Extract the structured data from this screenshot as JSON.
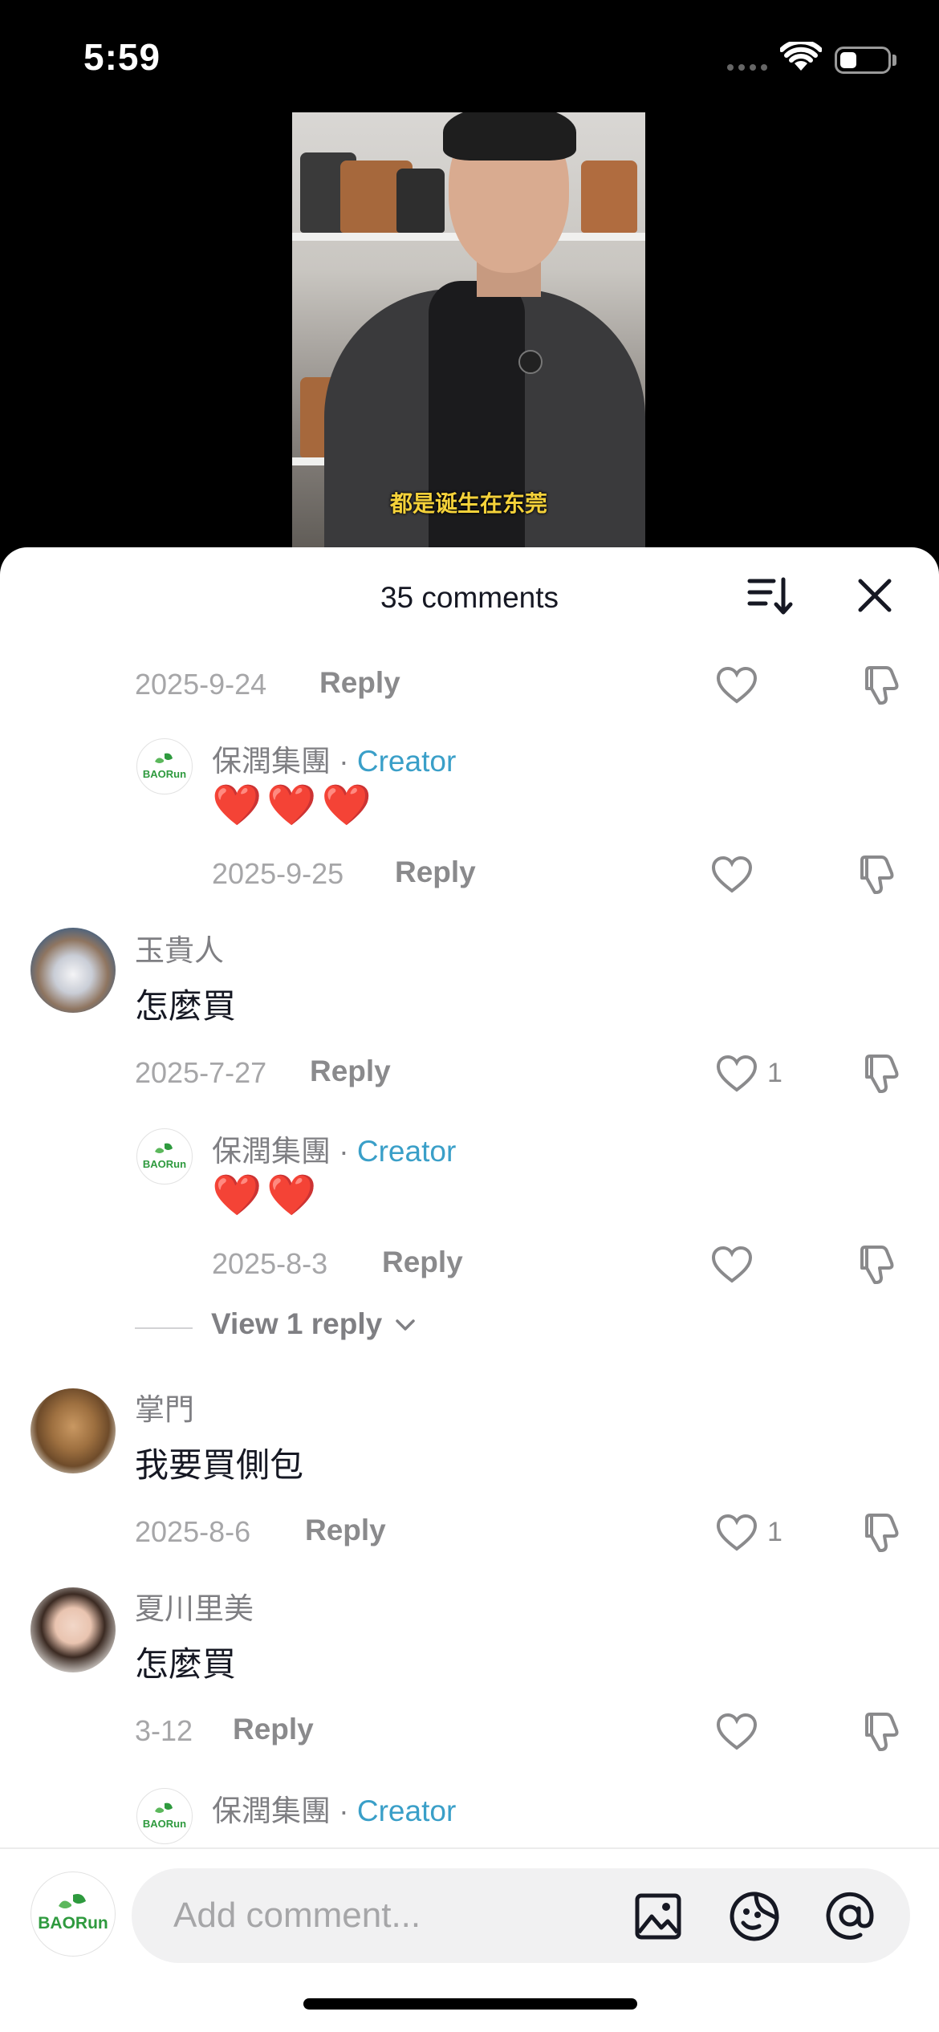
{
  "status": {
    "time": "5:59",
    "battery_level": 0.35
  },
  "video": {
    "subtitle": "都是诞生在东莞"
  },
  "sheet": {
    "title": "35 comments",
    "sort_icon": "sort-icon",
    "close_icon": "close-icon"
  },
  "comments": {
    "reply0": {
      "date": "2025-9-24",
      "reply_label": "Reply"
    },
    "creator1": {
      "name": "保潤集團",
      "badge": "Creator",
      "text": "❤️❤️❤️",
      "date": "2025-9-25",
      "reply_label": "Reply"
    },
    "c2": {
      "name": "玉貴人",
      "text": "怎麼買",
      "date": "2025-7-27",
      "reply_label": "Reply",
      "likes": "1"
    },
    "creator2": {
      "name": "保潤集團",
      "badge": "Creator",
      "text": "❤️❤️",
      "date": "2025-8-3",
      "reply_label": "Reply",
      "view_replies": "View 1 reply"
    },
    "c3": {
      "name": "掌門",
      "text": "我要買側包",
      "date": "2025-8-6",
      "reply_label": "Reply",
      "likes": "1"
    },
    "c4": {
      "name": "夏川里美",
      "text": "怎麼買",
      "date": "3-12",
      "reply_label": "Reply"
    },
    "creator3": {
      "name": "保潤集團",
      "badge": "Creator"
    }
  },
  "logo_text": "BAORun",
  "composer": {
    "placeholder": "Add comment...",
    "icons": [
      "image-icon",
      "emoji-icon",
      "mention-icon"
    ]
  },
  "colors": {
    "creator_accent": "#3a9fc8",
    "subtitle": "#f5d23a"
  }
}
